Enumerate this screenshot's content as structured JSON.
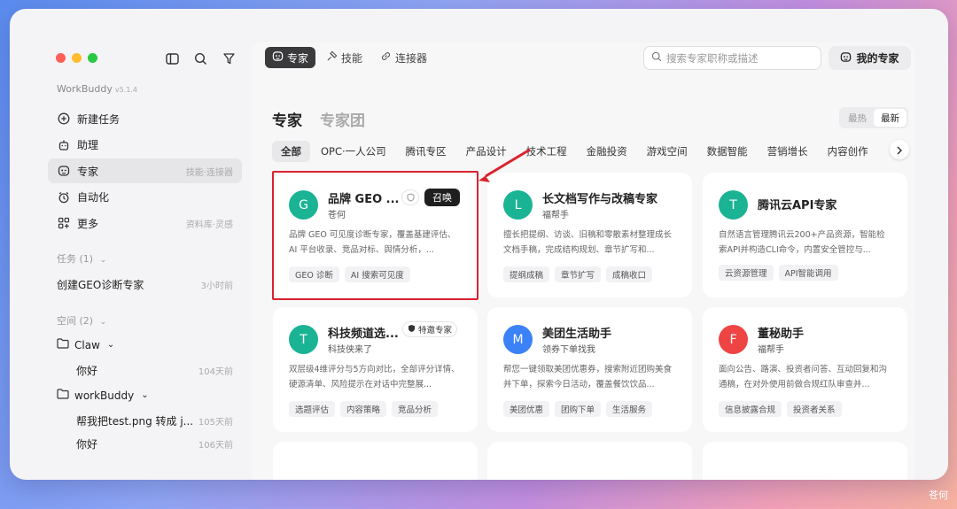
{
  "window_controls": {
    "colors": [
      "#ff5f57",
      "#febc2e",
      "#28c840"
    ]
  },
  "sidebar": {
    "app_name": "WorkBuddy",
    "version": "v5.1.4",
    "nav": [
      {
        "label": "新建任务",
        "icon": "plus-circle-icon",
        "hint": ""
      },
      {
        "label": "助理",
        "icon": "robot-icon",
        "hint": ""
      },
      {
        "label": "专家",
        "icon": "expert-icon",
        "hint": "技能·连接器"
      },
      {
        "label": "自动化",
        "icon": "alarm-clock-icon",
        "hint": ""
      },
      {
        "label": "更多",
        "icon": "grid-plus-icon",
        "hint": "资料库·灵感"
      }
    ],
    "tasks_title": "任务 (1)",
    "tasks": [
      {
        "label": "创建GEO诊断专家",
        "time": "3小时前"
      }
    ],
    "spaces_title": "空间 (2)",
    "spaces": [
      {
        "name": "Claw",
        "items": [
          {
            "label": "你好",
            "time": "104天前"
          }
        ]
      },
      {
        "name": "workBuddy",
        "items": [
          {
            "label": "帮我把test.png 转成 j...",
            "time": "105天前"
          },
          {
            "label": "你好",
            "time": "106天前"
          }
        ]
      }
    ]
  },
  "topbar": {
    "tabs": [
      {
        "label": "专家",
        "icon": "expert-icon",
        "active": true
      },
      {
        "label": "技能",
        "icon": "skill-icon",
        "active": false
      },
      {
        "label": "连接器",
        "icon": "link-icon",
        "active": false
      }
    ],
    "search_placeholder": "搜索专家职称或描述",
    "my_experts": "我的专家"
  },
  "page": {
    "title": "专家",
    "title_alt": "专家团",
    "sort": [
      "最热",
      "最新"
    ],
    "sort_active": "最新",
    "categories": [
      "全部",
      "OPC·一人公司",
      "腾讯专区",
      "产品设计",
      "技术工程",
      "金融投资",
      "游戏空间",
      "数据智能",
      "营销增长",
      "内容创作"
    ]
  },
  "cards": [
    {
      "initial": "G",
      "color": "#1ab394",
      "name": "品牌 GEO ...",
      "author": "苍何",
      "desc": "品牌 GEO 可见度诊断专家，覆盖基建评估、AI 平台收录、竞品对标、舆情分析，...",
      "tags": [
        "GEO 诊断",
        "AI 搜索可见度"
      ],
      "summon": "召唤"
    },
    {
      "initial": "L",
      "color": "#1ab394",
      "name": "长文档写作与改稿专家",
      "author": "福帮手",
      "desc": "擅长把提纲、访谈、旧稿和零散素材整理成长文档手稿，完成结构规划、章节扩写和...",
      "tags": [
        "提纲成稿",
        "章节扩写",
        "成稿收口"
      ]
    },
    {
      "initial": "T",
      "color": "#1ab394",
      "name": "腾讯云API专家",
      "author": "",
      "desc": "自然语言管理腾讯云200+产品资源，智能检索API并构造CLI命令，内置安全管控与...",
      "tags": [
        "云资源管理",
        "API智能调用"
      ]
    },
    {
      "initial": "T",
      "color": "#1ab394",
      "name": "科技频道选...",
      "author": "科技侠来了",
      "desc": "双层级4维评分与5方向对比，全部评分详情、硬源清单、风险提示在对话中完整展...",
      "tags": [
        "选题评估",
        "内容策略",
        "竞品分析"
      ],
      "badge": "特邀专家"
    },
    {
      "initial": "M",
      "color": "#3b82f6",
      "name": "美团生活助手",
      "author": "领券下单找我",
      "desc": "帮您一键领取美团优惠券，搜索附近团购美食并下单，探索今日活动，覆盖餐饮饮品...",
      "tags": [
        "美团优惠",
        "团购下单",
        "生活服务"
      ]
    },
    {
      "initial": "F",
      "color": "#ef4444",
      "name": "董秘助手",
      "author": "福帮手",
      "desc": "面向公告、路演、投资者问答、互动回复和沟通稿，在对外使用前做合规红队审查并...",
      "tags": [
        "信息披露合规",
        "投资者关系"
      ]
    }
  ],
  "watermark": "苍何"
}
